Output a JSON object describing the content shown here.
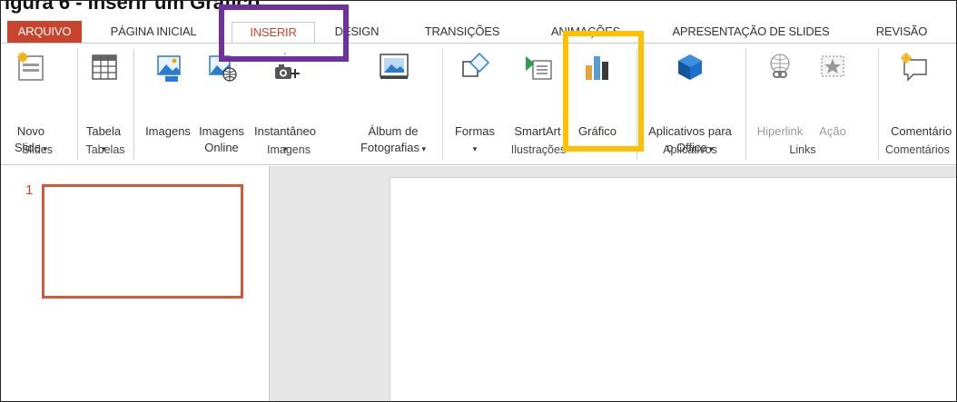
{
  "caption": "igura 6 - Inserir um Gráfico",
  "tabs": [
    {
      "label": "ARQUIVO"
    },
    {
      "label": "PÁGINA INICIAL"
    },
    {
      "label": "INSERIR"
    },
    {
      "label": "DESIGN"
    },
    {
      "label": "TRANSIÇÕES"
    },
    {
      "label": "ANIMAÇÕES"
    },
    {
      "label": "APRESENTAÇÃO DE SLIDES"
    },
    {
      "label": "REVISÃO"
    }
  ],
  "ribbon": {
    "slides": {
      "group": "Slides",
      "novo_slide": [
        "Novo",
        "Slide"
      ]
    },
    "tabelas": {
      "group": "Tabelas",
      "tabela": "Tabela"
    },
    "imagens": {
      "group": "Imagens",
      "imagens": "Imagens",
      "imagens_online": [
        "Imagens",
        "Online"
      ],
      "instantaneo": "Instantâneo",
      "album": [
        "Álbum de",
        "Fotografias"
      ]
    },
    "ilustracoes": {
      "group": "Ilustrações",
      "formas": "Formas",
      "smartart": "SmartArt",
      "grafico": "Gráfico"
    },
    "aplicativos": {
      "group": "Aplicativos",
      "apps": [
        "Aplicativos para",
        "o Office"
      ]
    },
    "links": {
      "group": "Links",
      "hiperlink": "Hiperlink",
      "acao": "Ação"
    },
    "comentarios": {
      "group": "Comentários",
      "comentario": "Comentário"
    }
  },
  "slides_pane": {
    "slide_number": "1"
  },
  "colors": {
    "accent": "#c8442d",
    "highlight_tab": "#7030a0",
    "highlight_button": "#ffc000"
  }
}
